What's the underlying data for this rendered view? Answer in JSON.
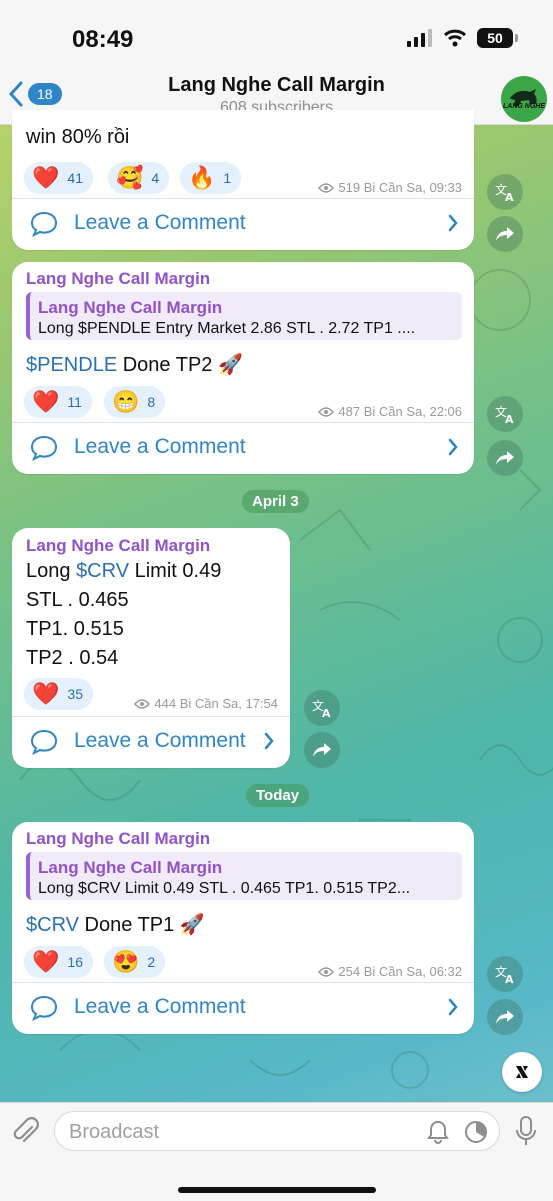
{
  "status_bar": {
    "time": "08:49",
    "battery": "50"
  },
  "header": {
    "back_count": "18",
    "title": "Lang Nghe Call Margin",
    "subtitle": "608 subscribers",
    "avatar_text": "LANG NGHE"
  },
  "messages": [
    {
      "text": "win 80% rồi",
      "reactions": [
        {
          "emoji": "❤️",
          "count": "41"
        },
        {
          "emoji": "🥰",
          "count": "4"
        },
        {
          "emoji": "🔥",
          "count": "1"
        }
      ],
      "meta": "519 Bi Cần Sa, 09:33",
      "comment_label": "Leave a Comment"
    },
    {
      "sender": "Lang Nghe Call Margin",
      "quote_name": "Lang Nghe Call Margin",
      "quote_text": "Long $PENDLE Entry Market 2.86 STL . 2.72 TP1 ....",
      "tag": "$PENDLE",
      "text": " Done TP2 ",
      "reactions": [
        {
          "emoji": "❤️",
          "count": "11"
        },
        {
          "emoji": "😁",
          "count": "8"
        }
      ],
      "meta": "487 Bi Cần Sa, 22:06",
      "comment_label": "Leave a Comment"
    },
    {
      "sender": "Lang Nghe Call Margin",
      "line1_prefix": "Long ",
      "line1_tag": "$CRV",
      "line1_suffix": " Limit 0.49",
      "line2": "STL . 0.465",
      "line3": "TP1. 0.515",
      "line4": "TP2 . 0.54",
      "reactions": [
        {
          "emoji": "❤️",
          "count": "35"
        }
      ],
      "meta": "444 Bi Cần Sa, 17:54",
      "comment_label": "Leave a Comment"
    },
    {
      "sender": "Lang Nghe Call Margin",
      "quote_name": "Lang Nghe Call Margin",
      "quote_text": "Long $CRV Limit 0.49 STL . 0.465 TP1. 0.515 TP2...",
      "tag": "$CRV",
      "text": " Done TP1 ",
      "reactions": [
        {
          "emoji": "❤️",
          "count": "16"
        },
        {
          "emoji": "😍",
          "count": "2"
        }
      ],
      "meta": "254 Bi Cần Sa, 06:32",
      "comment_label": "Leave a Comment"
    }
  ],
  "date_separators": [
    "April 3",
    "Today"
  ],
  "bottom_bar": {
    "placeholder": "Broadcast"
  },
  "colors": {
    "accent": "#2f86c6",
    "sender": "#9253c8",
    "reaction_bg": "#e4f0fb"
  }
}
